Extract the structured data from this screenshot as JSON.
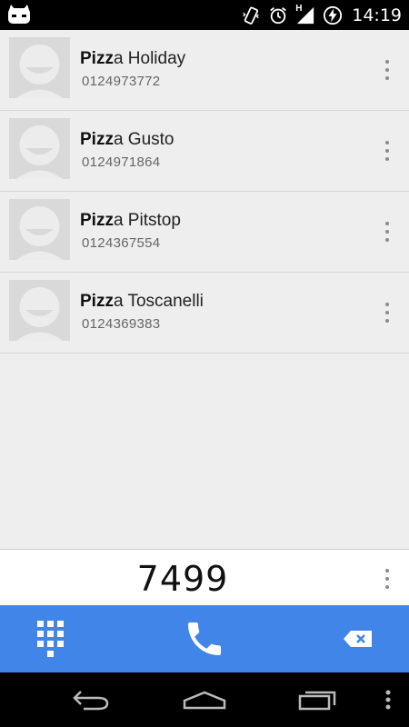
{
  "status_bar": {
    "time": "14:19",
    "network_label": "H",
    "icons": [
      "cyanogenmod-icon",
      "vibrate-icon",
      "alarm-icon",
      "signal-icon",
      "battery-charging-icon"
    ]
  },
  "contacts": [
    {
      "name_match": "Pizz",
      "name_rest": "a Holiday",
      "number": "0124973772"
    },
    {
      "name_match": "Pizz",
      "name_rest": "a Gusto",
      "number": "0124971864"
    },
    {
      "name_match": "Pizz",
      "name_rest": "a Pitstop",
      "number": "0124367554"
    },
    {
      "name_match": "Pizz",
      "name_rest": "a Toscanelli",
      "number": "0124369383"
    }
  ],
  "dialer": {
    "digits": "7499"
  },
  "action_bar": {
    "icons": [
      "dialpad-icon",
      "call-icon",
      "backspace-icon"
    ],
    "accent_color": "#4285e8"
  },
  "nav_bar": {
    "icons": [
      "back-icon",
      "home-icon",
      "recents-icon",
      "menu-icon"
    ]
  }
}
